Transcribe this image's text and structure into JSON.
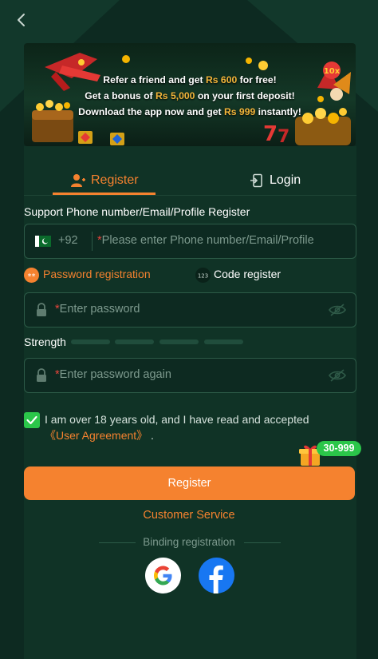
{
  "banner": {
    "line1": {
      "before": "Refer a friend and get ",
      "highlight": "Rs 600",
      "after": " for free!"
    },
    "line2": {
      "before": "Get a bonus of ",
      "highlight": "Rs 5,000",
      "after": " on your first deposit!"
    },
    "line3": {
      "before": "Download the app now and get ",
      "highlight": "Rs 999",
      "after": " instantly!"
    },
    "tag": "10x"
  },
  "tabs": {
    "register": "Register",
    "login": "Login"
  },
  "form": {
    "support_label": "Support Phone number/Email/Profile Register",
    "country_code": "+92",
    "identity_placeholder": "Please enter Phone number/Email/Profile",
    "password_mode_label": "Password registration",
    "code_mode_label": "Code register",
    "code_mode_icon_text": "123",
    "password_placeholder": "Enter password",
    "strength_label": "Strength",
    "confirm_placeholder": "Enter password again",
    "required_mark": "*"
  },
  "agreement": {
    "text": "I am over 18 years old, and I have read and accepted ",
    "link": "《User Agreement》",
    "end": " ."
  },
  "gift_badge": "30-999",
  "register_button": "Register",
  "customer_service": "Customer Service",
  "binding_label": "Binding registration",
  "social": [
    "google",
    "facebook"
  ],
  "colors": {
    "background": "#0d2a21",
    "panel": "#103326",
    "accent": "#f5822f",
    "success": "#2bc64a",
    "muted": "#7d9a8e"
  }
}
